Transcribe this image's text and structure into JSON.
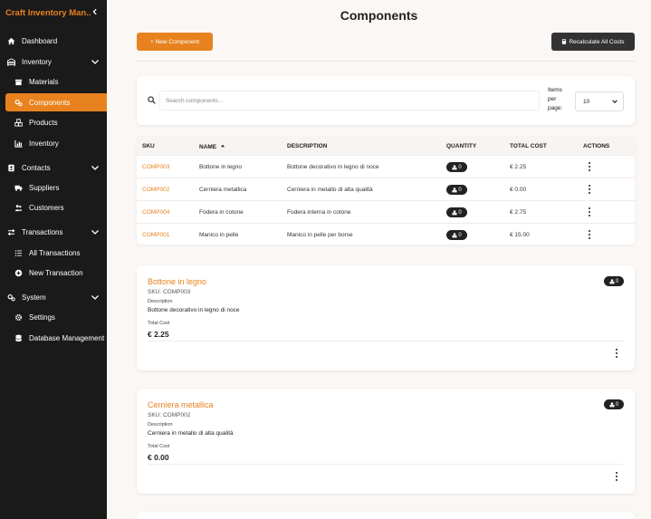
{
  "app": {
    "title": "Craft Inventory Man..."
  },
  "sidebar": {
    "dashboard": "Dashboard",
    "inventory_group": "Inventory",
    "materials": "Materials",
    "components": "Components",
    "products": "Products",
    "inventory": "Inventory",
    "contacts_group": "Contacts",
    "suppliers": "Suppliers",
    "customers": "Customers",
    "transactions_group": "Transactions",
    "all_transactions": "All Transactions",
    "new_transaction": "New Transaction",
    "system_group": "System",
    "settings": "Settings",
    "database_management": "Database Management"
  },
  "page": {
    "title": "Components",
    "new_button": "+ New Component",
    "recalc_button": "Recalculate All Costs"
  },
  "search": {
    "placeholder": "Search components...",
    "items_per_page_label": "Items per page:",
    "items_per_page_value": "10"
  },
  "table": {
    "headers": {
      "sku": "SKU",
      "name": "NAME",
      "description": "DESCRIPTION",
      "quantity": "QUANTITY",
      "total_cost": "TOTAL COST",
      "actions": "ACTIONS"
    },
    "rows": [
      {
        "sku": "COMP003",
        "name": "Bottone in legno",
        "description": "Bottone decorativo in legno di noce",
        "quantity": "0",
        "total_cost": "€ 2.25"
      },
      {
        "sku": "COMP002",
        "name": "Cerniera metallica",
        "description": "Cerniera in metallo di alta qualità",
        "quantity": "0",
        "total_cost": "€ 0.00"
      },
      {
        "sku": "COMP004",
        "name": "Fodera in cotone",
        "description": "Fodera interna in cotone",
        "quantity": "0",
        "total_cost": "€ 2.75"
      },
      {
        "sku": "COMP001",
        "name": "Manico in pelle",
        "description": "Manico in pelle per borse",
        "quantity": "0",
        "total_cost": "€ 15.00"
      }
    ]
  },
  "cards": [
    {
      "title": "Bottone in legno",
      "sku": "SKU: COMP003",
      "desc_label": "Description",
      "description": "Bottone decorativo in legno di noce",
      "cost_label": "Total Cost",
      "cost": "€ 2.25",
      "quantity": "0"
    },
    {
      "title": "Cerniera metallica",
      "sku": "SKU: COMP002",
      "desc_label": "Description",
      "description": "Cerniera in metallo di alta qualità",
      "cost_label": "Total Cost",
      "cost": "€ 0.00",
      "quantity": "0"
    }
  ],
  "colors": {
    "accent": "#e8821e",
    "sidebar_bg": "#1a1a1a",
    "dark_button": "#333333",
    "page_bg": "#faf7f5"
  }
}
